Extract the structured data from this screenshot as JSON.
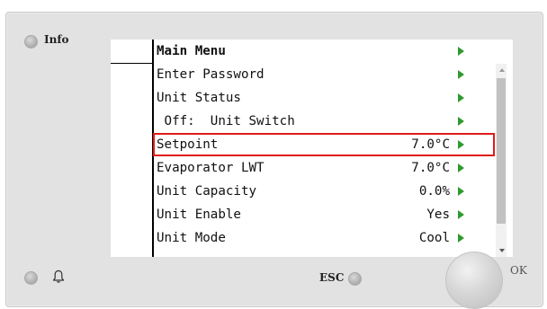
{
  "controls": {
    "info_label": "Info",
    "esc_label": "ESC",
    "ok_label": "OK"
  },
  "menu": {
    "title": "Main Menu",
    "items": [
      {
        "label": "Enter Password",
        "value": ""
      },
      {
        "label": "Unit Status",
        "value": ""
      },
      {
        "label": " Off:  Unit Switch",
        "value": ""
      },
      {
        "label": "Setpoint",
        "value": "7.0°C"
      },
      {
        "label": "Evaporator LWT",
        "value": "7.0°C"
      },
      {
        "label": "Unit Capacity",
        "value": "0.0%"
      },
      {
        "label": "Unit Enable",
        "value": "Yes"
      },
      {
        "label": "Unit Mode",
        "value": "Cool"
      }
    ],
    "highlighted_item": "Setpoint"
  },
  "colors": {
    "arrow": "#2f9a2f",
    "highlight": "#e01a1a",
    "panel": "#e2e2e2"
  },
  "icons": {
    "bell": "bell-icon",
    "arrow": "play-arrow-icon"
  }
}
